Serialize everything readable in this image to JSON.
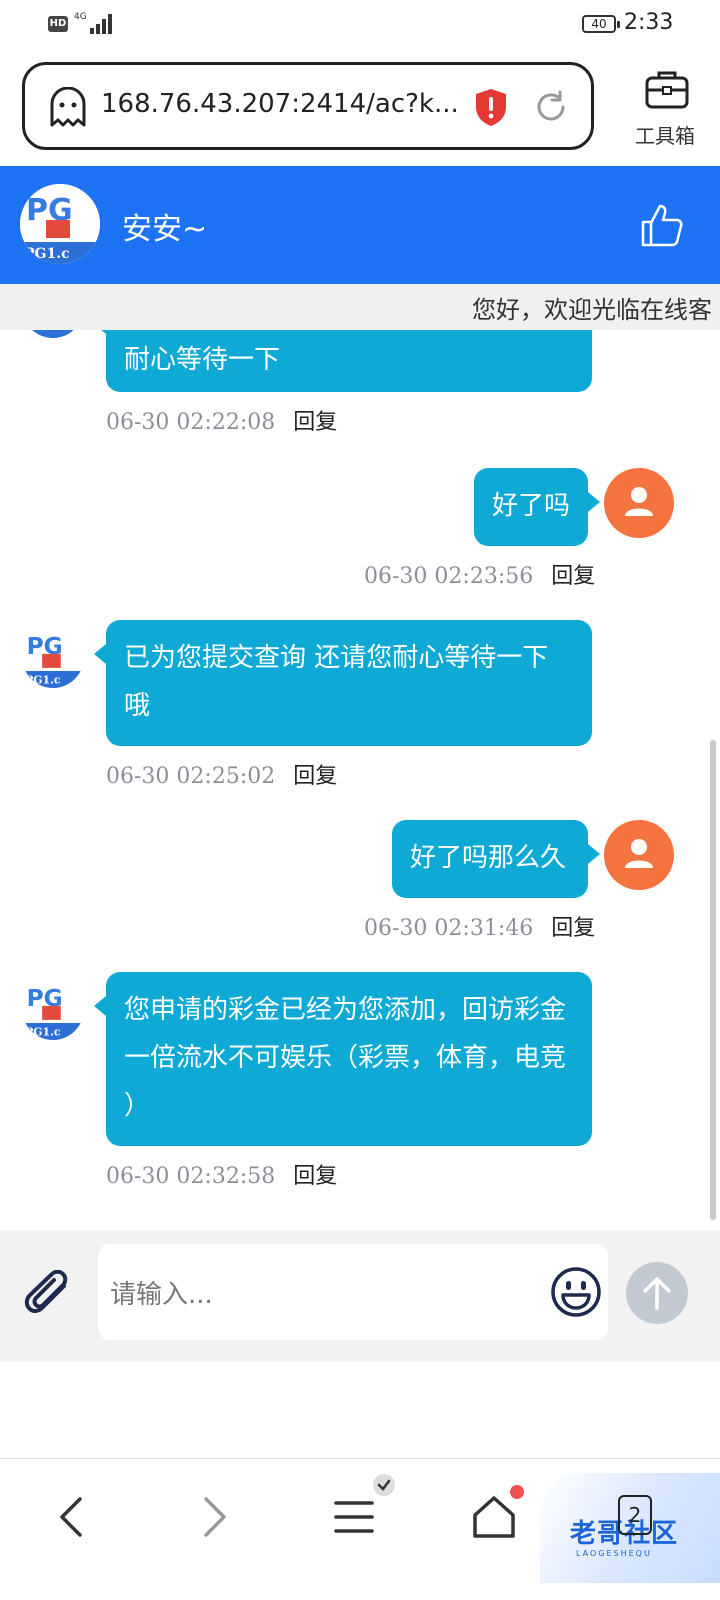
{
  "status_bar": {
    "hd": "HD",
    "network": "4G",
    "battery": "40",
    "time": "2:33"
  },
  "browser": {
    "url": "168.76.43.207:2414/ac?k...",
    "toolbox_label": "工具箱"
  },
  "chat_header": {
    "name": "安安~"
  },
  "marquee": {
    "text": "您好，欢迎光临在线客"
  },
  "messages": [
    {
      "side": "left",
      "text": "耐心等待一下",
      "time": "06-30 02:22:08",
      "reply": "回复"
    },
    {
      "side": "right",
      "text": "好了吗",
      "time": "06-30 02:23:56",
      "reply": "回复"
    },
    {
      "side": "left",
      "text": "已为您提交查询 还请您耐心等待一下哦",
      "time": "06-30 02:25:02",
      "reply": "回复"
    },
    {
      "side": "right",
      "text": "好了吗那么久",
      "time": "06-30 02:31:46",
      "reply": "回复"
    },
    {
      "side": "left",
      "text": "您申请的彩金已经为您添加，回访彩金一倍流水不可娱乐（彩票，体育，电竞 ）",
      "time": "06-30 02:32:58",
      "reply": "回复"
    }
  ],
  "input": {
    "placeholder": "请输入..."
  },
  "bottom_nav": {
    "tab_count": "2",
    "watermark": "老哥社区",
    "watermark_sub": "LAOGESHEQU"
  },
  "colors": {
    "header": "#1d73f4",
    "bubble": "#0fa9d6",
    "user_avatar": "#f5733f"
  },
  "icons": [
    "ghost-icon",
    "shield-icon",
    "reload-icon",
    "toolbox-icon",
    "thumbs-up-icon",
    "paperclip-icon",
    "emoji-icon",
    "arrow-up-icon",
    "back-icon",
    "forward-icon",
    "menu-icon",
    "home-icon"
  ]
}
